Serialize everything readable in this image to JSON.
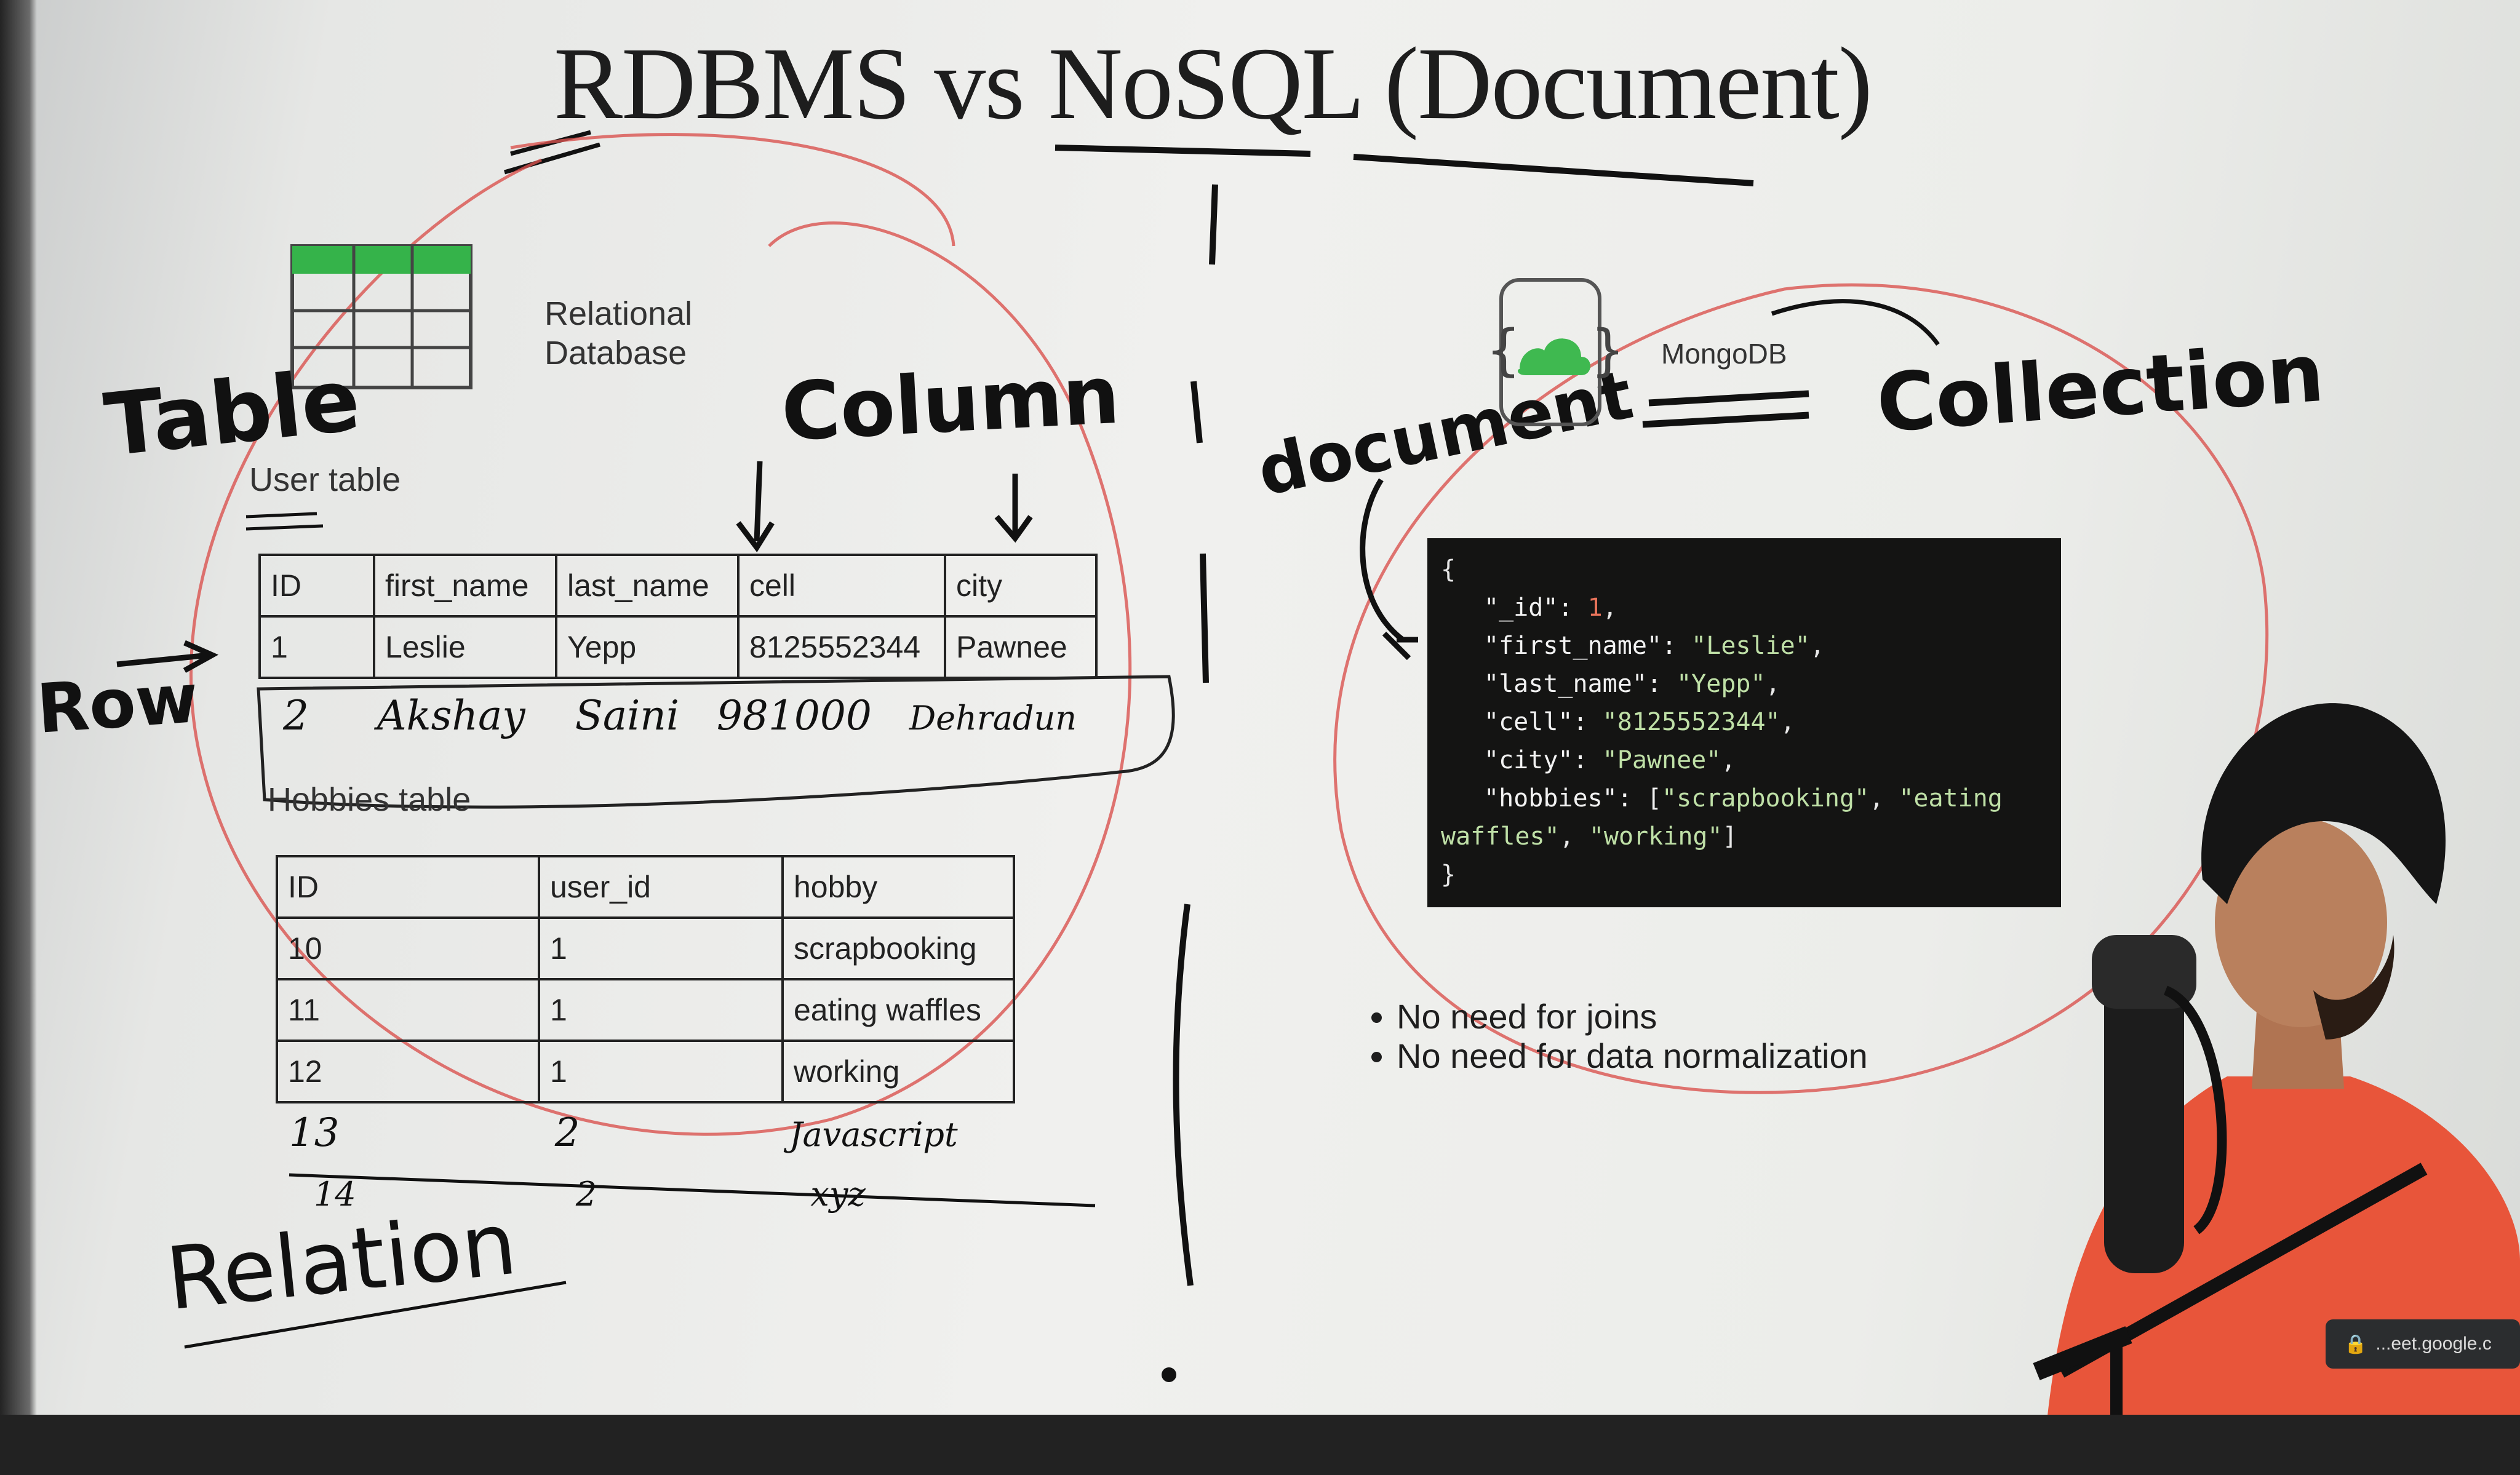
{
  "slide": {
    "title": "RDBMS vs NoSQL (Document)",
    "relational_label_line1": "Relational",
    "relational_label_line2": "Database",
    "user_table_caption": "User table",
    "user_table": {
      "headers": [
        "ID",
        "first_name",
        "last_name",
        "cell",
        "city"
      ],
      "rows": [
        [
          "1",
          "Leslie",
          "Yepp",
          "8125552344",
          "Pawnee"
        ]
      ]
    },
    "hobbies_table_caption": "Hobbies table",
    "hobbies_table": {
      "headers": [
        "ID",
        "user_id",
        "hobby"
      ],
      "rows": [
        [
          "10",
          "1",
          "scrapbooking"
        ],
        [
          "11",
          "1",
          "eating waffles"
        ],
        [
          "12",
          "1",
          "working"
        ]
      ]
    },
    "mongo_label": "MongoDB",
    "json_lines": {
      "open": "{",
      "id_key": "\"_id\": ",
      "id_val": "1",
      "first_key": "\"first_name\": ",
      "first_val": "\"Leslie\"",
      "last_key": "\"last_name\": ",
      "last_val": "\"Yepp\"",
      "cell_key": "\"cell\": ",
      "cell_val": "\"8125552344\"",
      "city_key": "\"city\": ",
      "city_val": "\"Pawnee\"",
      "hobbies_key": "\"hobbies\": [",
      "hobby1": "\"scrapbooking\"",
      "hobby2a": "\"eating",
      "hobby2b": "waffles\"",
      "hobby3": "\"working\"",
      "hobbies_close": "]",
      "close": "}"
    },
    "bullets": [
      "No need for joins",
      "No need for data normalization"
    ]
  },
  "annotations": {
    "table": "Table",
    "column": "Column",
    "row": "Row",
    "document": "document",
    "collection": "Collection",
    "relation": "Relation",
    "row2": [
      "2",
      "Akshay",
      "Saini",
      "981000",
      "Dehradun"
    ],
    "hobby_rows": [
      [
        "13",
        "2",
        "Javascript"
      ],
      [
        "14",
        "2",
        "xyz"
      ]
    ]
  },
  "meet": {
    "url": "...eet.google.c"
  },
  "colors": {
    "pen_red": "#d9534f",
    "ink": "#111111",
    "table_header_green": "#35b34a",
    "json_bg": "#141413",
    "mongo_green": "#3fb950",
    "shirt": "#e8553a"
  }
}
